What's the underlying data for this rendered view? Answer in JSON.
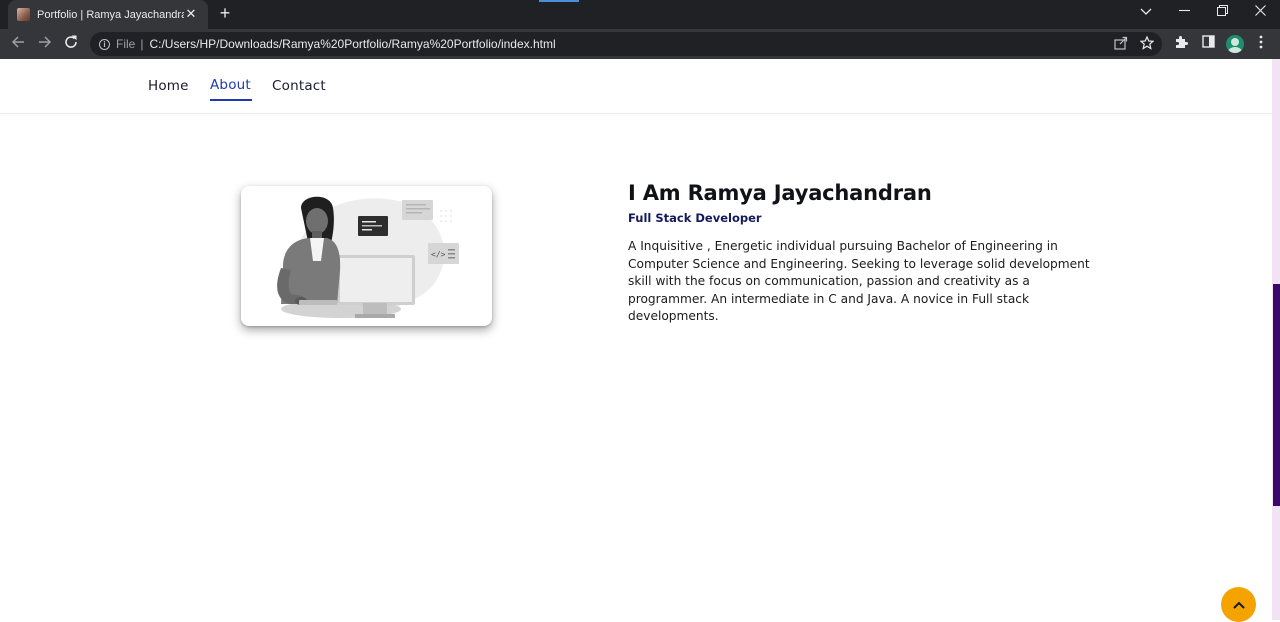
{
  "browser": {
    "tab_title": "Portfolio | Ramya Jayachandran",
    "tab_close": "✕",
    "new_tab": "+",
    "address_scheme": "File",
    "address_separator": "|",
    "address_url": "C:/Users/HP/Downloads/Ramya%20Portfolio/Ramya%20Portfolio/index.html"
  },
  "nav": {
    "items": [
      {
        "label": "Home"
      },
      {
        "label": "About"
      },
      {
        "label": "Contact"
      }
    ],
    "active": "About"
  },
  "about": {
    "name": "I Am Ramya Jayachandran",
    "role": "Full Stack Developer",
    "description": "A Inquisitive , Energetic individual pursuing Bachelor of Engineering in Computer Science and Engineering. Seeking to leverage solid development skill with the focus on communication, passion and creativity as a programmer. An intermediate in C and Java. A novice in Full stack developments.",
    "image_icon": "developer-illustration"
  },
  "colors": {
    "accent_nav": "#1f3bb3",
    "heading": "#111118",
    "role": "#151a5c",
    "back_to_top": "#f5a300",
    "scroll_thumb": "#3a0a6b"
  },
  "icons": {
    "back_to_top": "chevron-up-icon"
  }
}
